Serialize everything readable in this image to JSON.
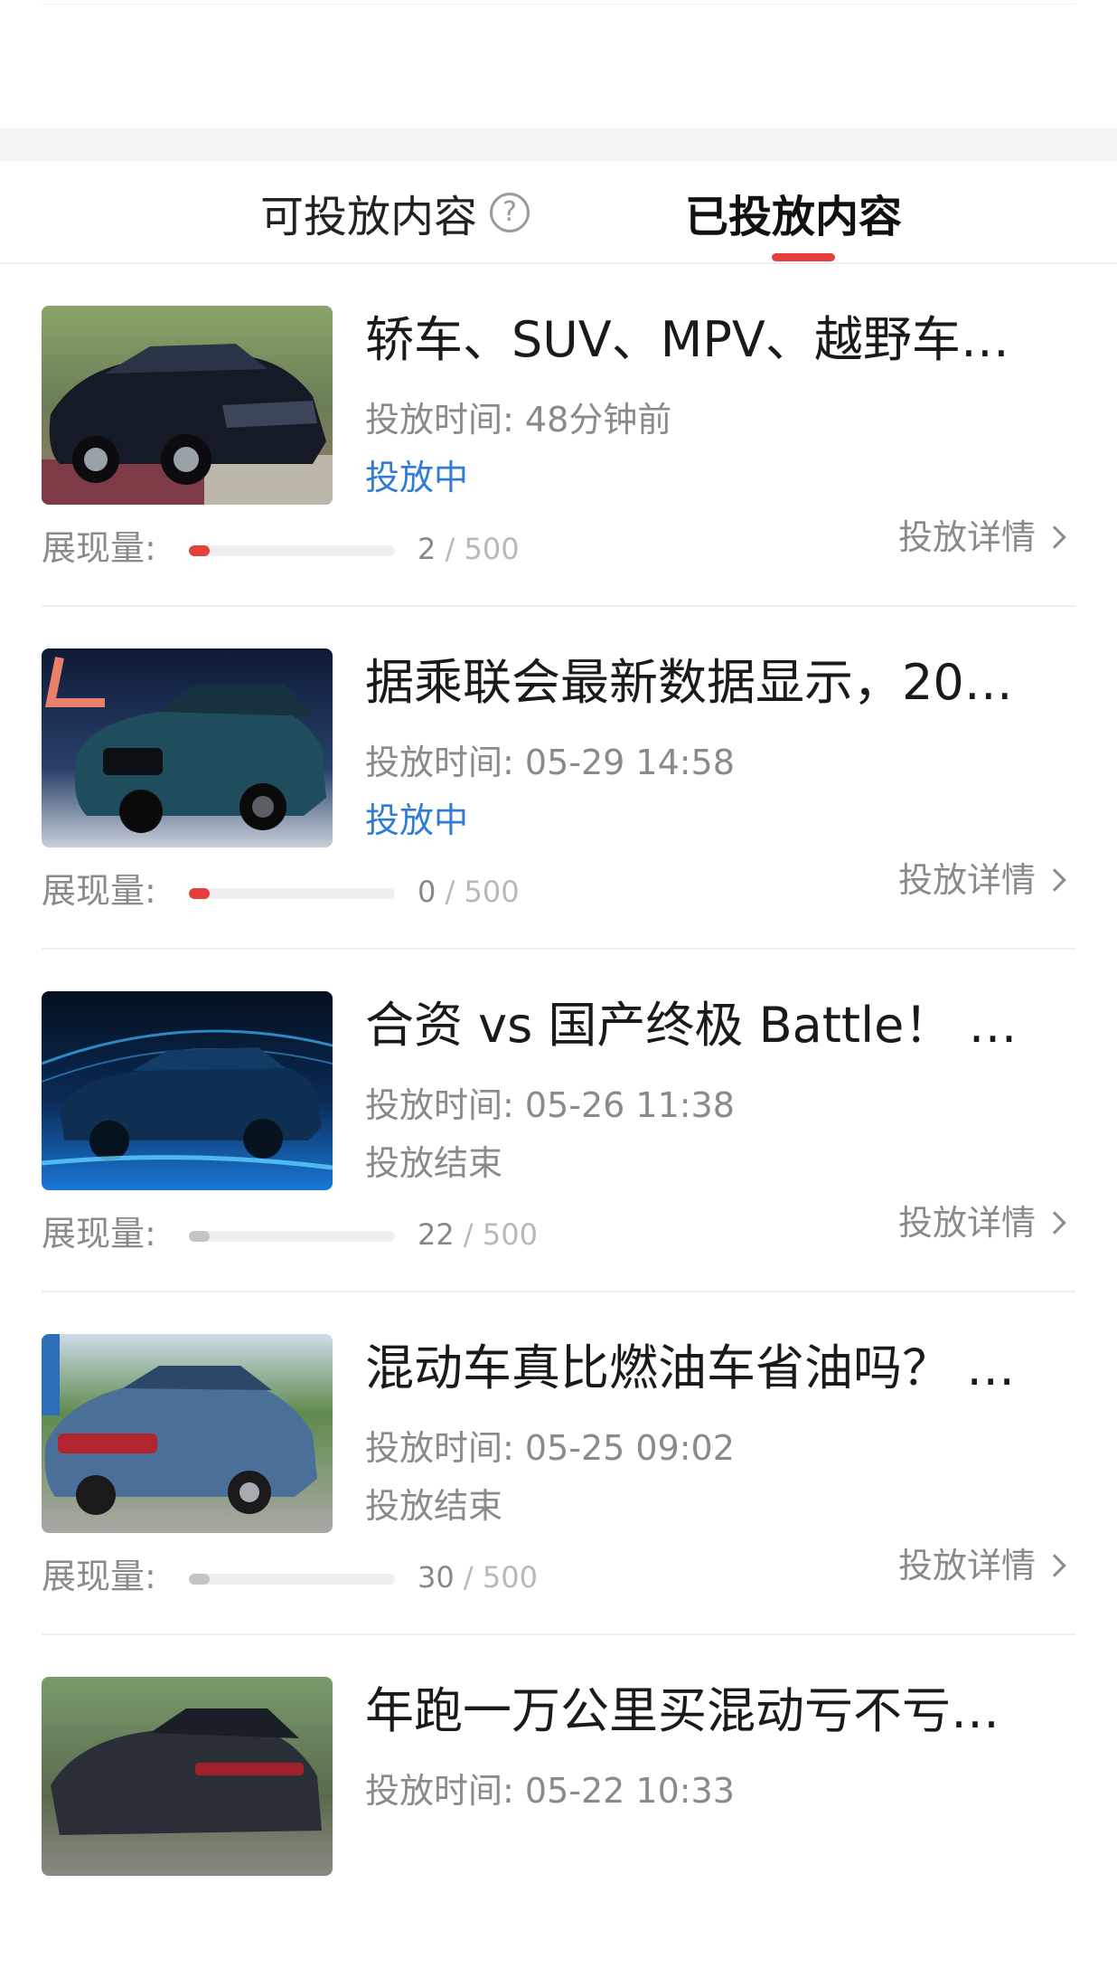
{
  "tabs": {
    "available": "可投放内容",
    "published": "已投放内容",
    "help_icon": "question-mark-circle-icon",
    "help_glyph": "?"
  },
  "colors": {
    "accent": "#e5403b",
    "active_status": "#2f7bd6",
    "ended_status": "#8a8a8a"
  },
  "items": [
    {
      "title": "轿车、SUV、MPV、越野车…",
      "time_label": "投放时间:",
      "time_value": "48分钟前",
      "status": "投放中",
      "status_type": "active",
      "metric_label": "展现量:",
      "current": "2",
      "separator": "/",
      "total": "500",
      "progress": 0.004,
      "detail": "投放详情",
      "thumb": "black-suv-photo"
    },
    {
      "title": "据乘联会最新数据显示，20…",
      "time_label": "投放时间:",
      "time_value": "05-29 14:58",
      "status": "投放中",
      "status_type": "active",
      "metric_label": "展现量:",
      "current": "0",
      "separator": "/",
      "total": "500",
      "progress": 0.0,
      "detail": "投放详情",
      "thumb": "teal-suv-photo"
    },
    {
      "title": "合资 vs 国产终极 Battle！ 2…",
      "time_label": "投放时间:",
      "time_value": "05-26 11:38",
      "status": "投放结束",
      "status_type": "ended",
      "metric_label": "展现量:",
      "current": "22",
      "separator": "/",
      "total": "500",
      "progress": 0.044,
      "detail": "投放详情",
      "thumb": "blue-wind-tunnel-car-photo"
    },
    {
      "title": "混动车真比燃油车省油吗？ …",
      "time_label": "投放时间:",
      "time_value": "05-25 09:02",
      "status": "投放结束",
      "status_type": "ended",
      "metric_label": "展现量:",
      "current": "30",
      "separator": "/",
      "total": "500",
      "progress": 0.06,
      "detail": "投放详情",
      "thumb": "blue-sedan-photo"
    },
    {
      "title": "年跑一万公里买混动亏不亏…",
      "time_label": "投放时间:",
      "time_value": "05-22 10:33",
      "status": "",
      "status_type": "ended",
      "metric_label": "",
      "current": "",
      "separator": "",
      "total": "",
      "progress": null,
      "detail": "",
      "thumb": "dark-suv-photo"
    }
  ]
}
